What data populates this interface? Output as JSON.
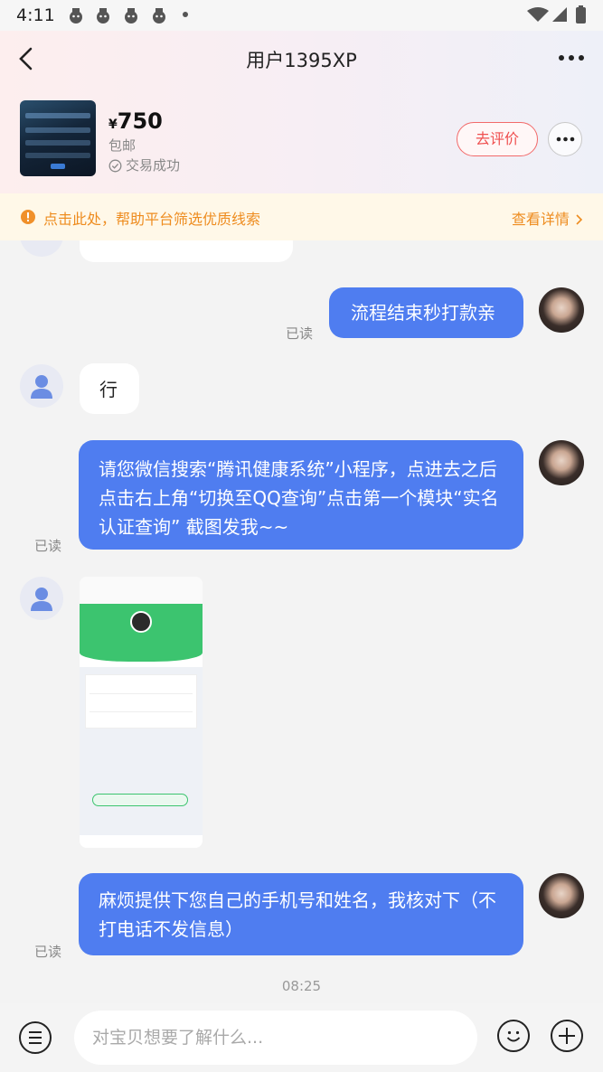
{
  "status_bar": {
    "time": "4:11"
  },
  "header": {
    "title": "用户1395XP",
    "product": {
      "currency_symbol": "¥",
      "price": "750",
      "shipping": "包邮",
      "status": "交易成功"
    },
    "review_button": "去评价"
  },
  "notice": {
    "text": "点击此处，帮助平台筛选优质线索",
    "link": "查看详情"
  },
  "messages": [
    {
      "from": "me",
      "text": "流程结束秒打款亲",
      "read": "已读"
    },
    {
      "from": "user",
      "text": "行"
    },
    {
      "from": "me",
      "text": "请您微信搜索“腾讯健康系统”小程序，点进去之后点击右上角“切换至QQ查询”点击第一个模块“实名认证查询” 截图发我~~",
      "read": "已读"
    },
    {
      "from": "user",
      "type": "image"
    },
    {
      "from": "me",
      "text": "麻烦提供下您自己的手机号和姓名，我核对下（不打电话不发信息）",
      "read": "已读"
    }
  ],
  "timestamp": "08:25",
  "input": {
    "placeholder": "对宝贝想要了解什么..."
  },
  "colors": {
    "accent": "#4f7df0",
    "warning": "#ee8c1f",
    "review": "#ef4f4f"
  }
}
